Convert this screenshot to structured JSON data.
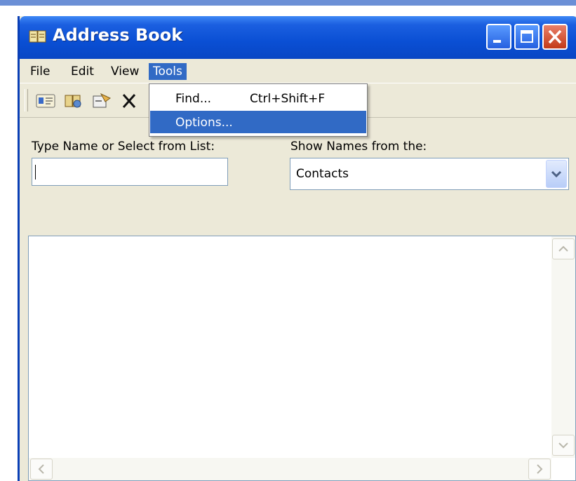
{
  "window": {
    "title": "Address Book"
  },
  "menubar": {
    "items": [
      "File",
      "Edit",
      "View",
      "Tools"
    ],
    "active": "Tools"
  },
  "tools_menu": {
    "items": [
      {
        "label": "Find...",
        "shortcut": "Ctrl+Shift+F"
      },
      {
        "label": "Options...",
        "shortcut": ""
      }
    ],
    "highlighted": "Options..."
  },
  "toolbar": {
    "icons": [
      "new-contact-icon",
      "properties-icon",
      "find-people-icon",
      "delete-icon"
    ]
  },
  "search": {
    "label": "Type Name or Select from List:",
    "value": ""
  },
  "show_names": {
    "label": "Show Names from the:",
    "selected": "Contacts"
  },
  "colors": {
    "titlebar": "#0a4fd4",
    "menu_highlight": "#316ac5",
    "window_bg": "#ece9d8",
    "close_button": "#c33a18"
  }
}
